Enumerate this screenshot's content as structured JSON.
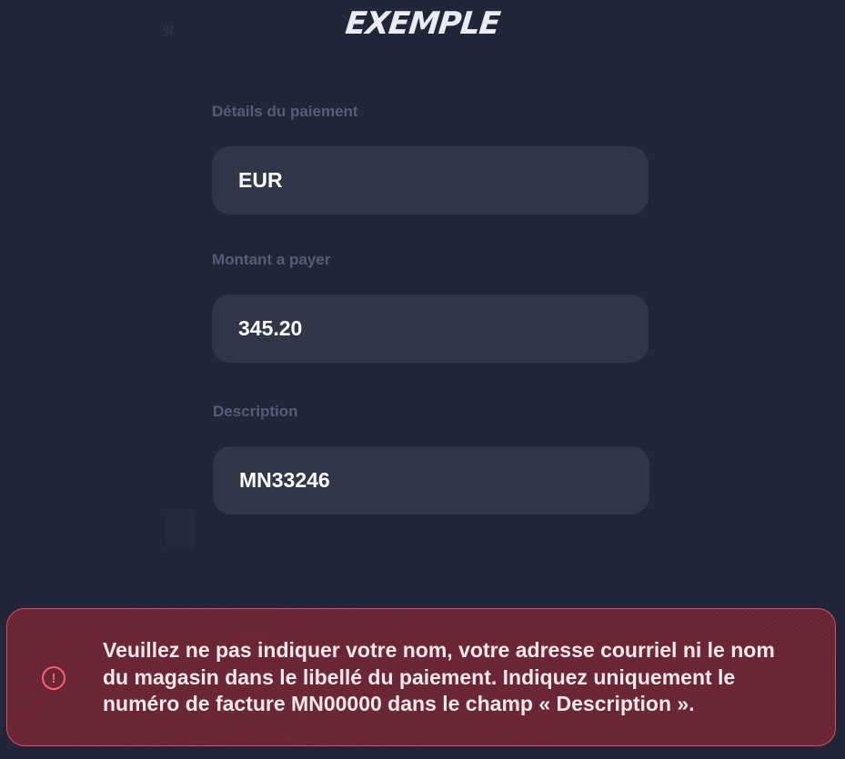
{
  "brand": {
    "logo_text": "EXEMPLE"
  },
  "form": {
    "fields": [
      {
        "label": "Détails du paiement",
        "value": "EUR"
      },
      {
        "label": "Montant a payer",
        "value": "345.20"
      },
      {
        "label": "Description",
        "value": "MN33246"
      }
    ]
  },
  "alert": {
    "icon": "exclamation-circle-icon",
    "message": "Veuillez ne pas indiquer votre nom, votre adresse courriel ni le nom du magasin dans le libellé du paiement. Indiquez uniquement le numéro de facture MN00000 dans le champ « Description ».",
    "border_color": "#e04a63",
    "background_color": "#6e2838",
    "icon_color": "#ff5f70"
  },
  "colors": {
    "page_background": "#212639",
    "field_background": "#313648",
    "label_color": "#575d76"
  }
}
